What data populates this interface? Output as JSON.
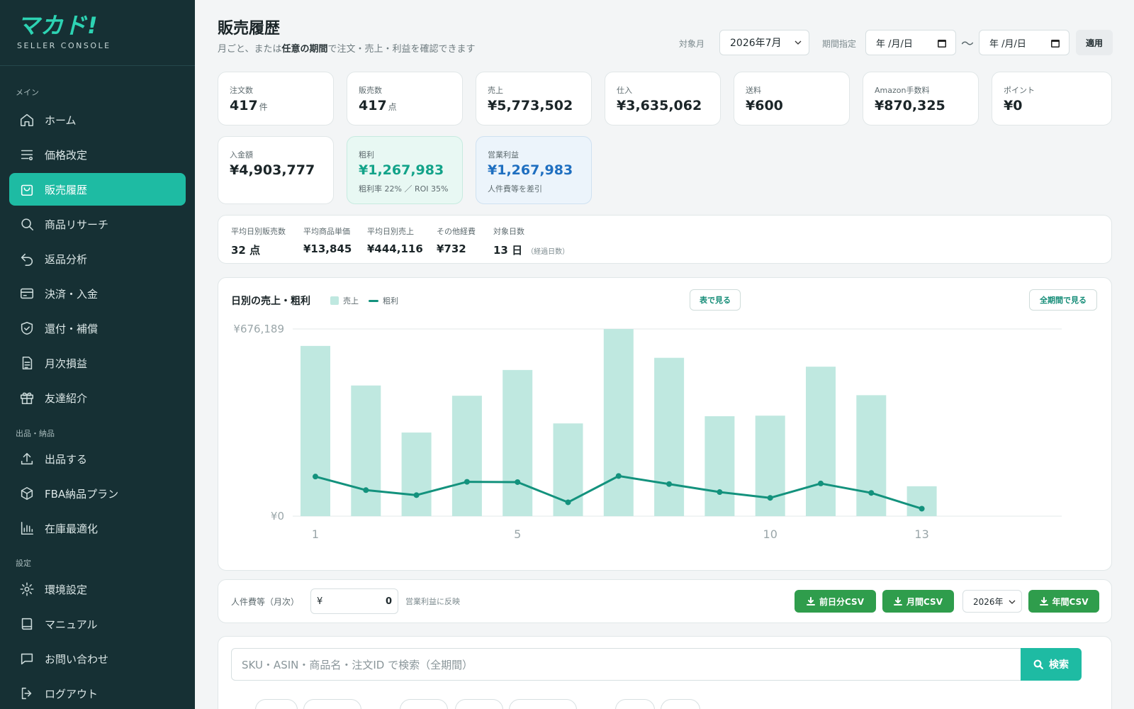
{
  "brand": {
    "logo": "マカド!",
    "subtitle": "SELLER CONSOLE"
  },
  "sidebar": {
    "sections": [
      {
        "label": "メイン"
      },
      {
        "label": "出品・納品"
      },
      {
        "label": "設定"
      }
    ],
    "items": [
      {
        "label": "ホーム",
        "icon": "home-icon",
        "active": false
      },
      {
        "label": "価格改定",
        "icon": "price-list-icon",
        "active": false
      },
      {
        "label": "販売履歴",
        "icon": "shopping-bag-icon",
        "active": true
      },
      {
        "label": "商品リサーチ",
        "icon": "search-icon",
        "active": false
      },
      {
        "label": "返品分析",
        "icon": "return-arrow-icon",
        "active": false
      },
      {
        "label": "決済・入金",
        "icon": "credit-card-icon",
        "active": false
      },
      {
        "label": "還付・補償",
        "icon": "shield-check-icon",
        "active": false
      },
      {
        "label": "月次損益",
        "icon": "document-icon",
        "active": false
      },
      {
        "label": "友達紹介",
        "icon": "gift-icon",
        "active": false
      },
      {
        "label": "出品する",
        "icon": "upload-icon",
        "active": false
      },
      {
        "label": "FBA納品プラン",
        "icon": "box-icon",
        "active": false
      },
      {
        "label": "在庫最適化",
        "icon": "bar-chart-icon",
        "active": false
      },
      {
        "label": "環境設定",
        "icon": "gear-icon",
        "active": false
      },
      {
        "label": "マニュアル",
        "icon": "book-icon",
        "active": false
      },
      {
        "label": "お問い合わせ",
        "icon": "chat-icon",
        "active": false
      },
      {
        "label": "ログアウト",
        "icon": "logout-icon",
        "active": false
      }
    ]
  },
  "header": {
    "title": "販売履歴",
    "subtitle_pre": "月ごと、または",
    "subtitle_bold": "任意の期間",
    "subtitle_post": "で注文・売上・利益を確認できます",
    "month_label": "対象月",
    "month_value": "2026年7月",
    "range_label": "期間指定",
    "date_from": "年 /月/日",
    "date_to": "年 /月/日",
    "range_sep": "〜",
    "apply": "適用"
  },
  "stats": [
    {
      "label": "注文数",
      "value": "417",
      "unit": "件"
    },
    {
      "label": "販売数",
      "value": "417",
      "unit": "点"
    },
    {
      "label": "売上",
      "value": "¥5,773,502"
    },
    {
      "label": "仕入",
      "value": "¥3,635,062"
    },
    {
      "label": "送料",
      "value": "¥600"
    },
    {
      "label": "Amazon手数料",
      "value": "¥870,325"
    },
    {
      "label": "ポイント",
      "value": "¥0"
    },
    {
      "label": "入金額",
      "value": "¥4,903,777"
    },
    {
      "label": "粗利",
      "value": "¥1,267,983",
      "note": "粗利率 22% ／ ROI 35%"
    },
    {
      "label": "営業利益",
      "value": "¥1,267,983",
      "note": "人件費等を差引"
    }
  ],
  "averages": [
    {
      "label": "平均日別販売数",
      "value": "32 点"
    },
    {
      "label": "平均商品単価",
      "value": "¥13,845"
    },
    {
      "label": "平均日別売上",
      "value": "¥444,116"
    },
    {
      "label": "その他経費",
      "value": "¥732"
    },
    {
      "label": "対象日数",
      "value": "13 日",
      "sub": "（経過日数）"
    }
  ],
  "chart": {
    "title": "日別の売上・粗利",
    "legend_sales": "売上",
    "legend_profit": "粗利",
    "table_btn": "表で見る",
    "all_btn": "全期間で見る"
  },
  "chart_data": {
    "type": "bar",
    "x": [
      1,
      2,
      3,
      4,
      5,
      6,
      7,
      8,
      9,
      10,
      11,
      12,
      13
    ],
    "x_tick_labels": [
      "1",
      "5",
      "10",
      "13"
    ],
    "y_tick_labels": [
      "¥676,189",
      "¥0"
    ],
    "ylim": [
      0,
      676189
    ],
    "grid": true,
    "legend_position": "top-left",
    "series": [
      {
        "name": "売上",
        "type": "bar",
        "color": "#bfe8e0",
        "values": [
          615000,
          472000,
          302000,
          435000,
          528000,
          335000,
          676189,
          572000,
          361000,
          363000,
          540000,
          437000,
          108000
        ]
      },
      {
        "name": "粗利",
        "type": "line",
        "color": "#13927d",
        "values": [
          143000,
          94000,
          76000,
          124000,
          123000,
          50000,
          145000,
          116000,
          87000,
          66000,
          118000,
          84000,
          27000
        ]
      }
    ]
  },
  "labor": {
    "label": "人件費等（月次）",
    "currency": "¥",
    "value": "0",
    "note": "営業利益に反映",
    "btn_prev_csv": "前日分CSV",
    "btn_month_csv": "月間CSV",
    "year_value": "2026年",
    "btn_year_csv": "年間CSV"
  },
  "search": {
    "placeholder": "SKU・ASIN・商品名・注文ID で検索（全期間）",
    "button": "検索"
  },
  "colors": {
    "sidebar_bg": "#163034",
    "accent": "#1ebba3",
    "csv_green": "#2f9d4c",
    "bar": "#bfe8e0",
    "line": "#13927d"
  }
}
